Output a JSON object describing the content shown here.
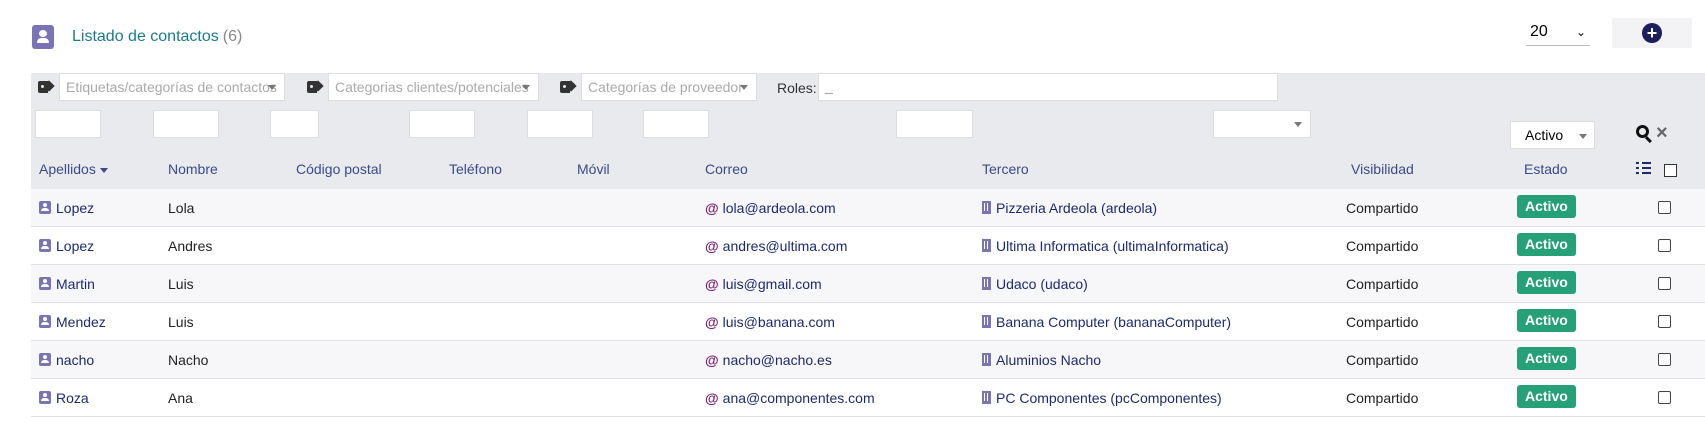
{
  "header": {
    "title": "Listado de contactos",
    "count": "(6)",
    "page_size": "20"
  },
  "filters": {
    "tags_contacts_placeholder": "Etiquetas/categorías de contactos",
    "tags_clients_placeholder": "Categorias clientes/potenciales",
    "tags_supplier_placeholder": "Categorías de proveedor",
    "roles_label": "Roles:",
    "roles_value": "_",
    "estado_value": "Activo"
  },
  "columns": {
    "apellidos": "Apellidos",
    "nombre": "Nombre",
    "codigo_postal": "Código postal",
    "telefono": "Teléfono",
    "movil": "Móvil",
    "correo": "Correo",
    "tercero": "Tercero",
    "visibilidad": "Visibilidad",
    "estado": "Estado"
  },
  "rows": [
    {
      "apellidos": "Lopez",
      "nombre": "Lola",
      "correo": "lola@ardeola.com",
      "tercero": "Pizzeria Ardeola (ardeola)",
      "visibilidad": "Compartido",
      "estado": "Activo"
    },
    {
      "apellidos": "Lopez",
      "nombre": "Andres",
      "correo": "andres@ultima.com",
      "tercero": "Ultima Informatica (ultimaInformatica)",
      "visibilidad": "Compartido",
      "estado": "Activo"
    },
    {
      "apellidos": "Martin",
      "nombre": "Luis",
      "correo": "luis@gmail.com",
      "tercero": "Udaco (udaco)",
      "visibilidad": "Compartido",
      "estado": "Activo"
    },
    {
      "apellidos": "Mendez",
      "nombre": "Luis",
      "correo": "luis@banana.com",
      "tercero": "Banana Computer (bananaComputer)",
      "visibilidad": "Compartido",
      "estado": "Activo"
    },
    {
      "apellidos": "nacho",
      "nombre": "Nacho",
      "correo": "nacho@nacho.es",
      "tercero": "Aluminios Nacho",
      "visibilidad": "Compartido",
      "estado": "Activo"
    },
    {
      "apellidos": "Roza",
      "nombre": "Ana",
      "correo": "ana@componentes.com",
      "tercero": "PC Componentes (pcComponentes)",
      "visibilidad": "Compartido",
      "estado": "Activo"
    }
  ],
  "colors": {
    "accent": "#1b7b8e",
    "link": "#1c2a6e",
    "status_active": "#26a077",
    "icon_purple": "#7a74b4",
    "filter_bg": "#e9eaed"
  },
  "icons": [
    "contact-book-icon",
    "chevron-down-icon",
    "plus-circle-icon",
    "tag-icon",
    "search-icon",
    "close-icon",
    "list-icon",
    "person-icon",
    "at-icon",
    "building-icon"
  ]
}
